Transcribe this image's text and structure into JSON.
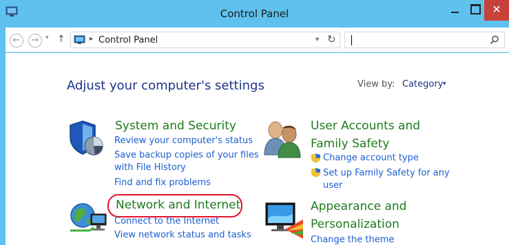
{
  "window": {
    "title": "Control Panel",
    "close_glyph": "✕"
  },
  "address": {
    "back_glyph": "←",
    "forward_glyph": "→",
    "recent_glyph": "▾",
    "up_glyph": "↑",
    "separator_glyph": "▸",
    "path": "Control Panel",
    "dropdown_glyph": "▾",
    "refresh_glyph": "↻",
    "search_value": ""
  },
  "main": {
    "heading": "Adjust your computer's settings",
    "view_by_label": "View by:",
    "view_by_value": "Category",
    "view_by_arrow": "▾"
  },
  "categories": [
    {
      "title": "System and Security",
      "icon": "system-security-icon",
      "links": [
        "Review your computer's status",
        "Save backup copies of your files",
        "with File History",
        "Find and fix problems"
      ]
    },
    {
      "title": "Network and Internet",
      "icon": "network-internet-icon",
      "links": [
        "Connect to the Internet",
        "View network status and tasks"
      ]
    },
    {
      "title_line1": "User Accounts and",
      "title_line2": "Family Safety",
      "icon": "user-accounts-icon",
      "links": [
        "Change account type",
        "Set up Family Safety for any",
        "user"
      ]
    },
    {
      "title_line1": "Appearance and",
      "title_line2": "Personalization",
      "icon": "appearance-icon",
      "links": [
        "Change the theme"
      ]
    }
  ],
  "colors": {
    "titlebar": "#5fc2ee",
    "close_button": "#c7423a",
    "heading": "#1e3287",
    "category_title": "#1e7a1e",
    "link": "#1a5fd0",
    "highlight": "#e8102a"
  }
}
